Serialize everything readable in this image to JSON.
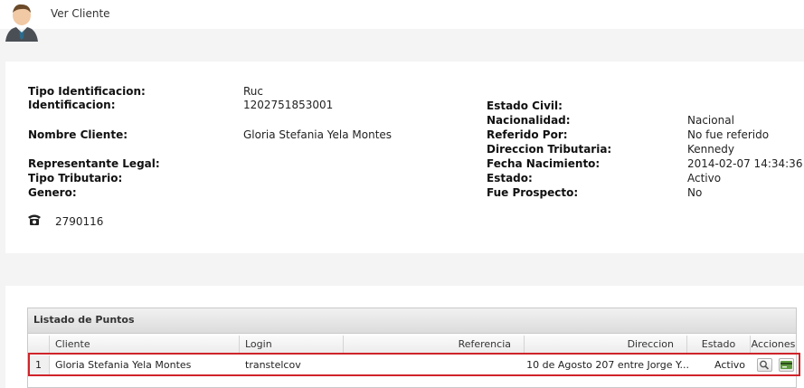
{
  "header": {
    "title": "Ver Cliente",
    "avatar_icon": "user-avatar-icon"
  },
  "client": {
    "left_fields": [
      {
        "label": "Tipo Identificacion:",
        "value": "Ruc"
      },
      {
        "label": "Identificacion:",
        "value": "1202751853001"
      },
      {
        "label": "Nombre Cliente:",
        "value": "Gloria Stefania Yela Montes"
      },
      {
        "label": "Representante Legal:",
        "value": ""
      },
      {
        "label": "Tipo Tributario:",
        "value": ""
      },
      {
        "label": "Genero:",
        "value": ""
      }
    ],
    "right_fields": [
      {
        "label": "Estado Civil:",
        "value": ""
      },
      {
        "label": "Nacionalidad:",
        "value": "Nacional"
      },
      {
        "label": "Referido Por:",
        "value": "No fue referido"
      },
      {
        "label": "Direccion Tributaria:",
        "value": "Kennedy"
      },
      {
        "label": "Fecha Nacimiento:",
        "value": "2014-02-07 14:34:36"
      },
      {
        "label": "Estado:",
        "value": "Activo"
      },
      {
        "label": "Fue Prospecto:",
        "value": "No"
      }
    ],
    "phone_icon": "telephone-icon",
    "phone": "2790116"
  },
  "points_grid": {
    "title": "Listado de Puntos",
    "columns": [
      "Cliente",
      "Login",
      "Referencia",
      "Direccion",
      "Estado",
      "Acciones"
    ],
    "rows": [
      {
        "num": "1",
        "cliente": "Gloria Stefania Yela Montes",
        "login": "transtelcov",
        "referencia": "",
        "direccion": "10 de Agosto 207 entre Jorge Y...",
        "estado": "Activo"
      }
    ],
    "action_icons": [
      "magnifier-icon",
      "card-icon"
    ]
  }
}
